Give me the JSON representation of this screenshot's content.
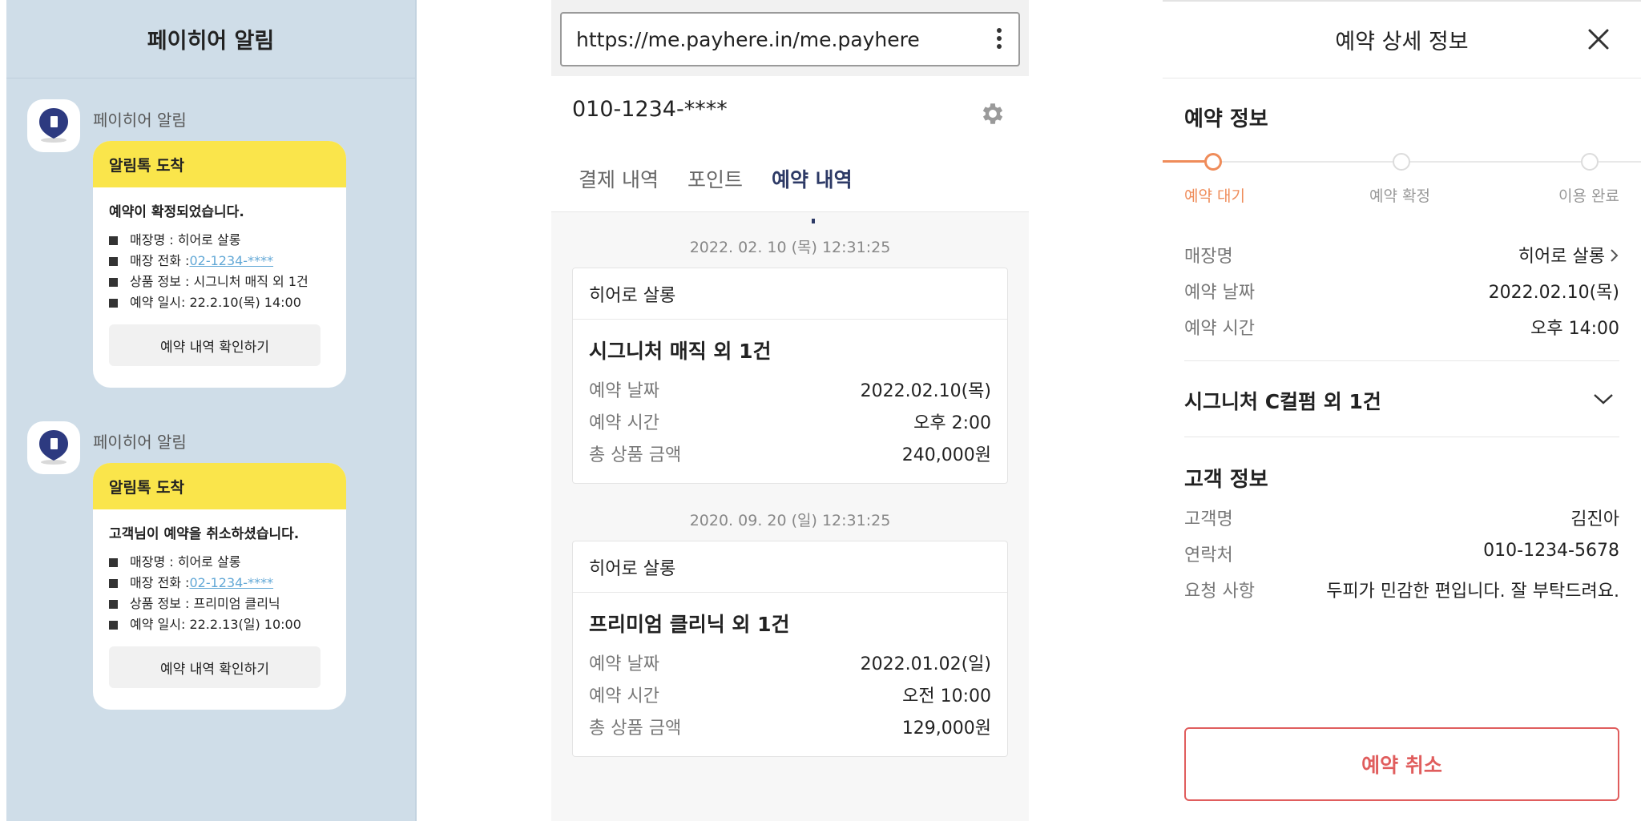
{
  "notifications": {
    "header_title": "페이히어 알림",
    "messages": [
      {
        "sender": "페이히어 알림",
        "header": "알림톡 도착",
        "title": "예약이 확정되었습니다.",
        "items": [
          {
            "text": "매장명 : 히어로 살롱",
            "link": ""
          },
          {
            "text": "매장 전화 : ",
            "link": "02-1234-****"
          },
          {
            "text": "상품 정보 : 시그니처 매직 외 1건",
            "link": ""
          },
          {
            "text": "예약 일시: 22.2.10(목) 14:00",
            "link": ""
          }
        ],
        "button": "예약 내역 확인하기"
      },
      {
        "sender": "페이히어 알림",
        "header": "알림톡 도착",
        "title": "고객님이 예약을 취소하셨습니다.",
        "items": [
          {
            "text": "매장명 : 히어로 살롱",
            "link": ""
          },
          {
            "text": "매장 전화 : ",
            "link": "02-1234-****"
          },
          {
            "text": "상품 정보 : 프리미엄 클리닉",
            "link": ""
          },
          {
            "text": "예약 일시: 22.2.13(일) 10:00",
            "link": ""
          }
        ],
        "button": "예약 내역 확인하기"
      }
    ]
  },
  "browser": {
    "url": "https://me.payhere.in/me.payhere",
    "phone": "010-1234-****",
    "tabs": [
      "결제 내역",
      "포인트",
      "예약 내역"
    ],
    "active_tab": "예약 내역",
    "reservations": [
      {
        "timestamp": "2022. 02. 10 (목) 12:31:25",
        "store": "히어로 살롱",
        "product": "시그니처 매직 외 1건",
        "rows": [
          {
            "label": "예약 날짜",
            "value": "2022.02.10(목)"
          },
          {
            "label": "예약 시간",
            "value": "오후 2:00"
          },
          {
            "label": "총 상품 금액",
            "value": "240,000원"
          }
        ]
      },
      {
        "timestamp": "2020. 09. 20 (일) 12:31:25",
        "store": "히어로 살롱",
        "product": "프리미엄 클리닉 외 1건",
        "rows": [
          {
            "label": "예약 날짜",
            "value": "2022.01.02(일)"
          },
          {
            "label": "예약 시간",
            "value": "오전 10:00"
          },
          {
            "label": "총 상품 금액",
            "value": "129,000원"
          }
        ]
      }
    ]
  },
  "detail": {
    "title": "예약 상세 정보",
    "reservation_section": "예약 정보",
    "steps": [
      "예약 대기",
      "예약 확정",
      "이용 완료"
    ],
    "current_step": "예약 대기",
    "info_rows": [
      {
        "label": "매장명",
        "value": "히어로 살롱"
      },
      {
        "label": "예약 날짜",
        "value": "2022.02.10(목)"
      },
      {
        "label": "예약 시간",
        "value": "오후 14:00"
      }
    ],
    "product": "시그니처 C컬펌 외 1건",
    "customer_section": "고객 정보",
    "customer_rows": [
      {
        "label": "고객명",
        "value": "김진아"
      },
      {
        "label": "연락처",
        "value": "010-1234-5678"
      },
      {
        "label": "요청 사항",
        "value": "두피가 민감한 편입니다. 잘 부탁드려요."
      }
    ],
    "cancel_button": "예약 취소"
  },
  "colors": {
    "kakao_yellow": "#fae54b",
    "chat_bg": "#cfdde8",
    "accent_navy": "#2d3a66",
    "step_orange": "#ef8c5a",
    "cancel_red": "#e05d5d",
    "link_blue": "#62a8d6"
  }
}
